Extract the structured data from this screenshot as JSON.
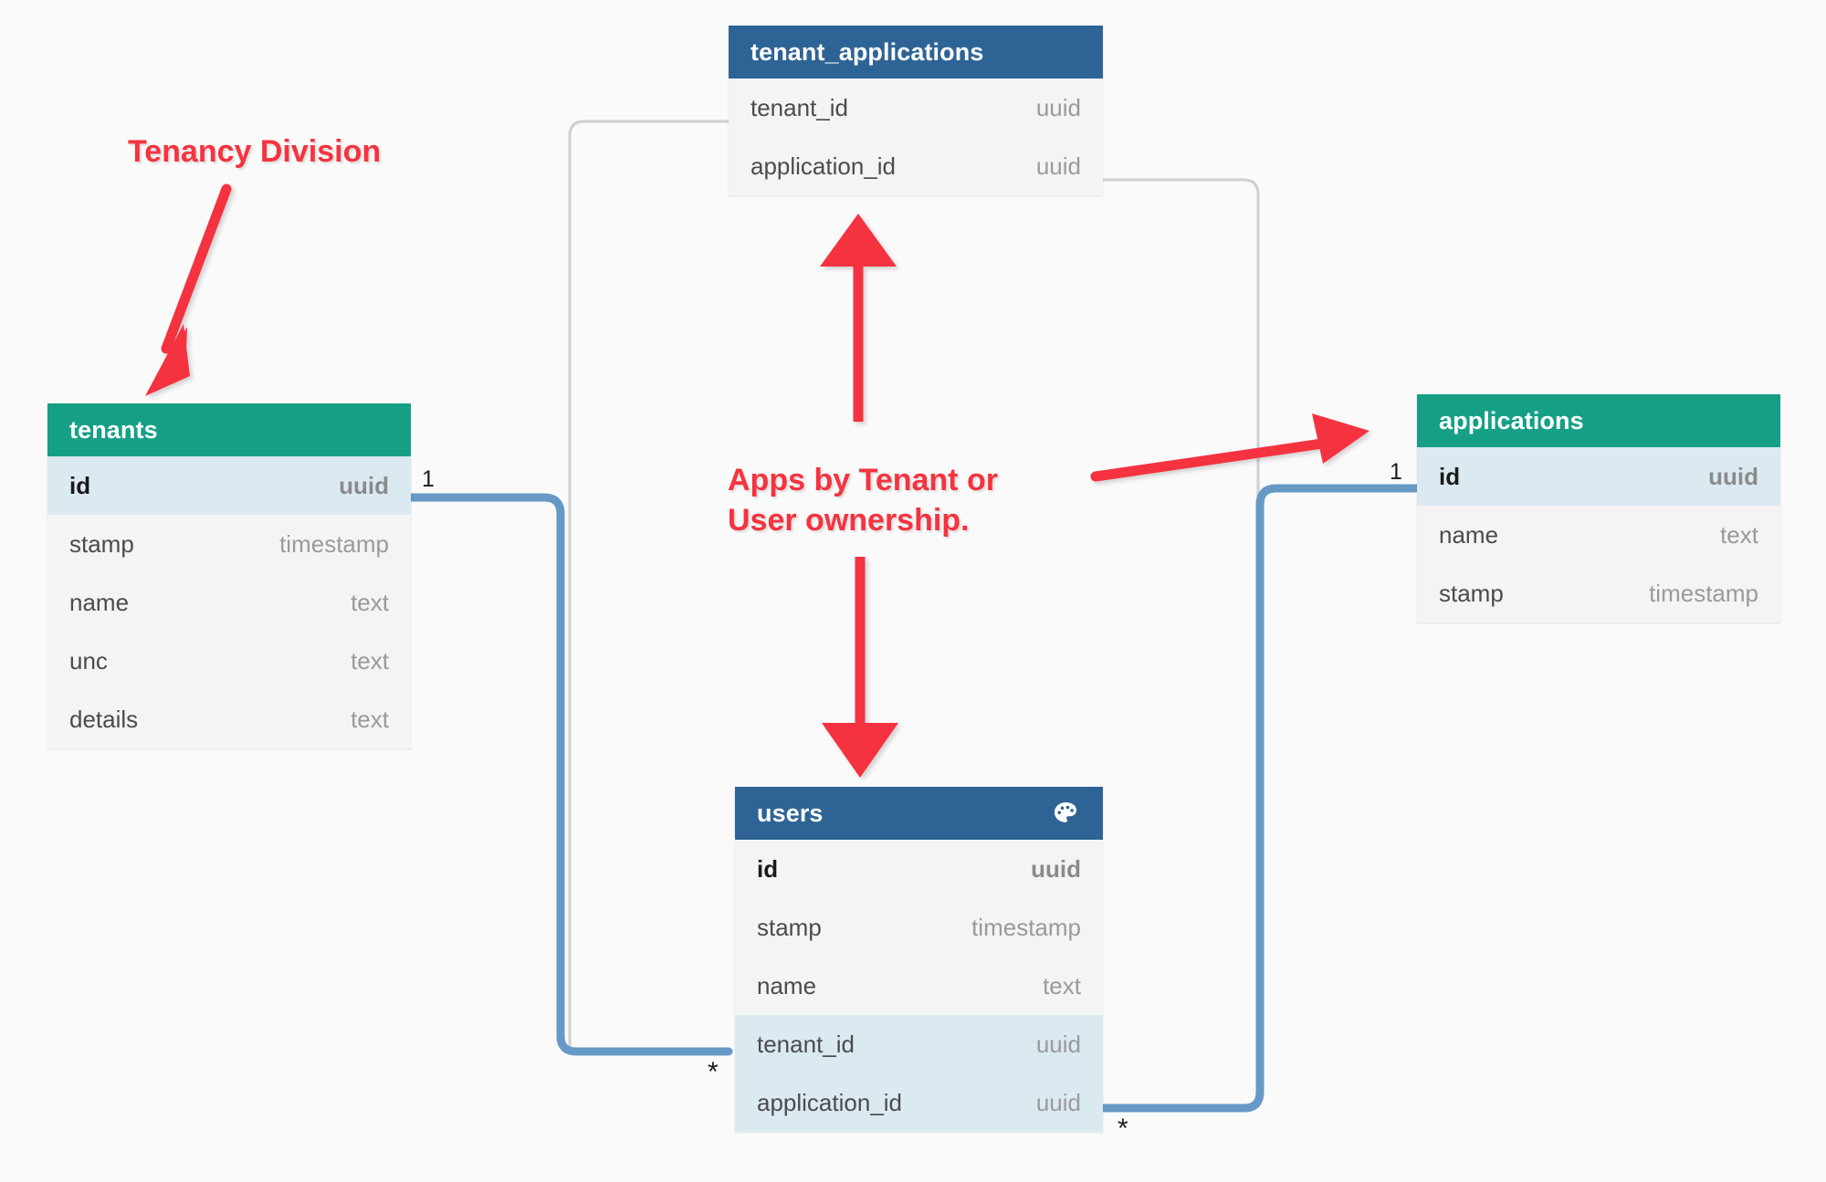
{
  "diagram": {
    "title": "Multi-tenant application schema ER diagram",
    "background_color": "#fafafa",
    "colors": {
      "entity_header_green": "#15a086",
      "entity_header_blue": "#2e6495",
      "key_row_background": "#dbe9f1",
      "row_background": "#f4f4f4",
      "relation_line": "#6699c6",
      "weak_relation_line": "#cccccc",
      "annotation_red": "#f5333f"
    }
  },
  "entities": [
    {
      "id": "tenant_applications",
      "name": "tenant_applications",
      "header_color": "blue",
      "icon": null,
      "fields": [
        {
          "name": "tenant_id",
          "type": "uuid",
          "key": false
        },
        {
          "name": "application_id",
          "type": "uuid",
          "key": false
        }
      ]
    },
    {
      "id": "tenants",
      "name": "tenants",
      "header_color": "green",
      "icon": null,
      "fields": [
        {
          "name": "id",
          "type": "uuid",
          "key": true
        },
        {
          "name": "stamp",
          "type": "timestamp",
          "key": false
        },
        {
          "name": "name",
          "type": "text",
          "key": false
        },
        {
          "name": "unc",
          "type": "text",
          "key": false
        },
        {
          "name": "details",
          "type": "text",
          "key": false
        }
      ]
    },
    {
      "id": "applications",
      "name": "applications",
      "header_color": "green",
      "icon": null,
      "fields": [
        {
          "name": "id",
          "type": "uuid",
          "key": true
        },
        {
          "name": "name",
          "type": "text",
          "key": false
        },
        {
          "name": "stamp",
          "type": "timestamp",
          "key": false
        }
      ]
    },
    {
      "id": "users",
      "name": "users",
      "header_color": "blue",
      "icon": "palette-icon",
      "fields": [
        {
          "name": "id",
          "type": "uuid",
          "key": true
        },
        {
          "name": "stamp",
          "type": "timestamp",
          "key": false
        },
        {
          "name": "name",
          "type": "text",
          "key": false
        },
        {
          "name": "tenant_id",
          "type": "uuid",
          "key": true
        },
        {
          "name": "application_id",
          "type": "uuid",
          "key": true
        }
      ]
    }
  ],
  "cardinalities": [
    {
      "id": "tenants-one",
      "label": "1"
    },
    {
      "id": "applications-one",
      "label": "1"
    },
    {
      "id": "users-tenant-many",
      "label": "*"
    },
    {
      "id": "users-application-many",
      "label": "*"
    }
  ],
  "annotations": [
    {
      "id": "tenancy-division",
      "text": "Tenancy Division"
    },
    {
      "id": "apps-ownership",
      "text": "Apps by Tenant or\nUser ownership."
    }
  ]
}
